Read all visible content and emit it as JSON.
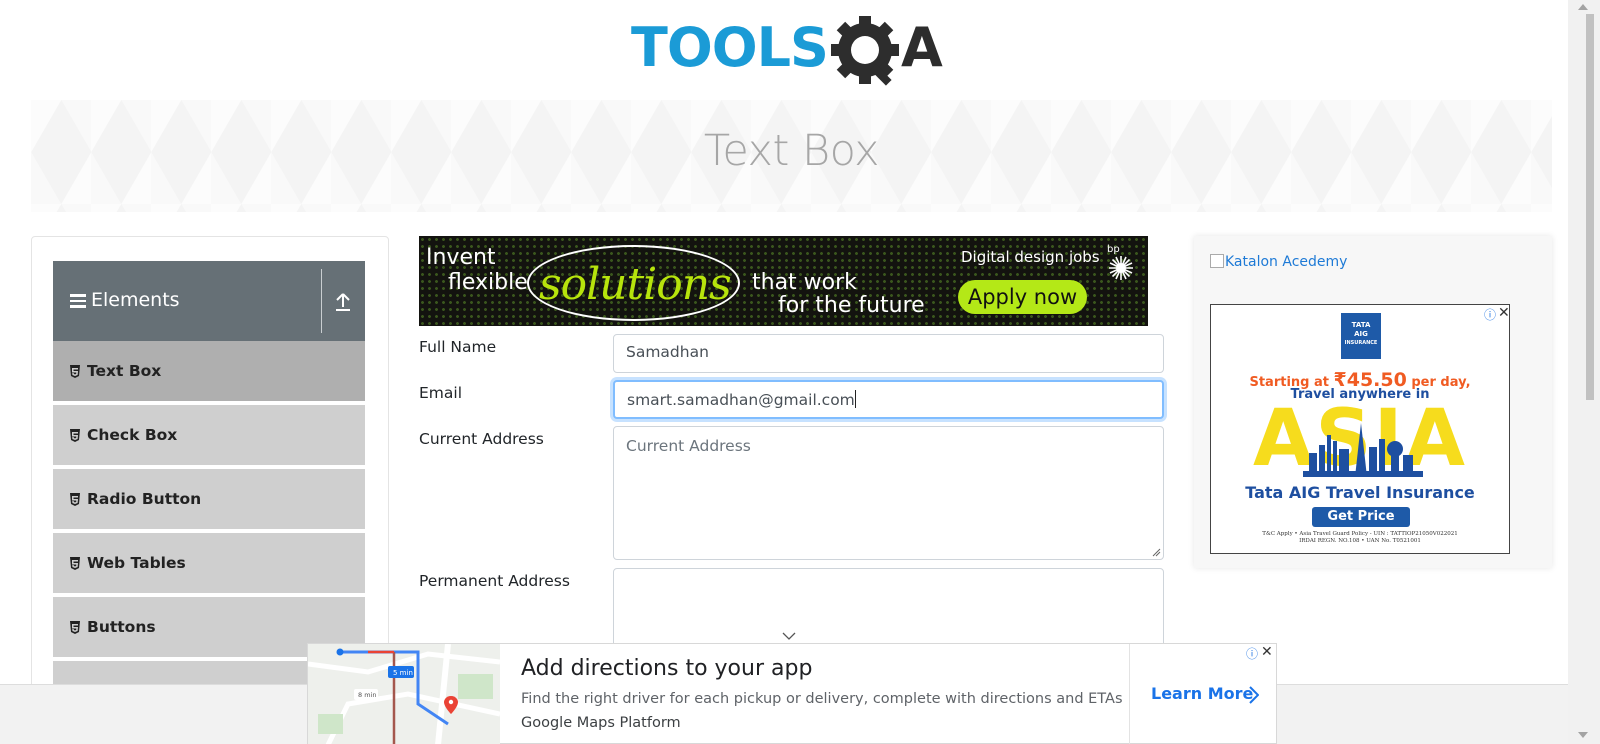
{
  "header": {
    "logo_text_left": "TOOLS",
    "logo_text_right": "A",
    "logo_color": "#1b9bd6",
    "logo_dark": "#2d2d2d"
  },
  "banner": {
    "title": "Text Box"
  },
  "sidebar": {
    "group_title": "Elements",
    "group_bg": "#667076",
    "items": [
      {
        "label": "Text Box",
        "active": true
      },
      {
        "label": "Check Box"
      },
      {
        "label": "Radio Button"
      },
      {
        "label": "Web Tables"
      },
      {
        "label": "Buttons"
      }
    ]
  },
  "top_ad": {
    "line1": "Invent",
    "line1b": "flexible",
    "highlight": "solutions",
    "line2": "that work",
    "line3": "for the future",
    "jobs": "Digital design jobs",
    "cta": "Apply now",
    "brand": "bp"
  },
  "form": {
    "full_name_label": "Full Name",
    "full_name_value": "Samadhan",
    "email_label": "Email",
    "email_value": "smart.samadhan@gmail.com",
    "current_address_label": "Current Address",
    "current_address_placeholder": "Current Address",
    "permanent_address_label": "Permanent Address"
  },
  "right_ad": {
    "image_alt": "Katalon Acedemy",
    "logo_line1": "TATA",
    "logo_line2": "AIG",
    "logo_line3": "INSURANCE",
    "starting_prefix": "Starting at ",
    "price": "₹45.50",
    "starting_suffix": " per day,",
    "travel_line": "Travel anywhere in",
    "headline": "ASIA",
    "product": "Tata AIG Travel Insurance",
    "cta": "Get Price",
    "fine_print_1": "T&C Apply • Asia Travel Guard Policy - UIN : TATTIOP21050V022021",
    "fine_print_2": "IRDAI REGN. NO.108 • UAN No. T0521001"
  },
  "bottom_ad": {
    "title": "Add directions to your app",
    "description": "Find the right driver for each pickup or delivery, complete with directions and ETAs",
    "brand": "Google Maps Platform",
    "cta": "Learn More",
    "map_label_1": "5 min",
    "map_label_2": "8 min"
  },
  "colors": {
    "accent_blue": "#1a73e8",
    "menu_item_bg": "#cfcfcf",
    "menu_active_bg": "#afafaf"
  }
}
